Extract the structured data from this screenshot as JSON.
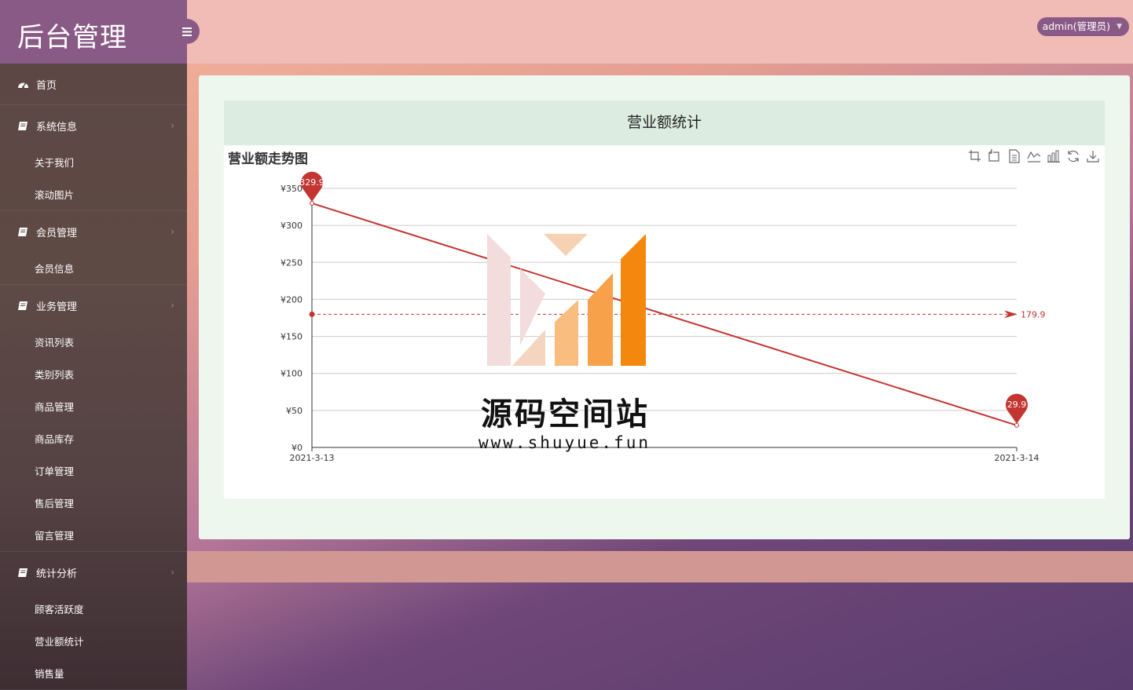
{
  "brand": {
    "title": "后台管理"
  },
  "header": {
    "user_label": "admin(管理员)"
  },
  "sidebar": {
    "home": "首页",
    "groups": [
      {
        "label": "系统信息",
        "items": [
          "关于我们",
          "滚动图片"
        ]
      },
      {
        "label": "会员管理",
        "items": [
          "会员信息"
        ]
      },
      {
        "label": "业务管理",
        "items": [
          "资讯列表",
          "类别列表",
          "商品管理",
          "商品库存",
          "订单管理",
          "售后管理",
          "留言管理"
        ]
      },
      {
        "label": "统计分析",
        "items": [
          "顾客活跃度",
          "营业额统计",
          "销售量"
        ]
      }
    ]
  },
  "card": {
    "header": "营业额统计"
  },
  "watermark": {
    "title": "源码空间站",
    "url": "www.shuyue.fun"
  },
  "colors": {
    "line": "#c23531",
    "brand": "#8a5a86",
    "topbar": "#f0bcb5"
  },
  "toolbox_icons": [
    "zoom-icon",
    "zoom-reset-icon",
    "data-view-icon",
    "line-chart-icon",
    "bar-chart-icon",
    "restore-icon",
    "save-image-icon"
  ],
  "chart_data": {
    "type": "line",
    "title": "营业额走势图",
    "categories": [
      "2021-3-13",
      "2021-3-14"
    ],
    "series": [
      {
        "values": [
          329.9,
          29.9
        ]
      }
    ],
    "ylim": [
      0,
      350
    ],
    "yticks": [
      "¥0",
      "¥50",
      "¥100",
      "¥150",
      "¥200",
      "¥250",
      "¥300",
      "¥350"
    ],
    "mark_points": [
      {
        "label": "329.9",
        "index": 0
      },
      {
        "label": "29.9",
        "index": 1
      }
    ],
    "mark_line": {
      "label": "179.9",
      "value": 179.9,
      "type": "average"
    },
    "grid": true
  }
}
